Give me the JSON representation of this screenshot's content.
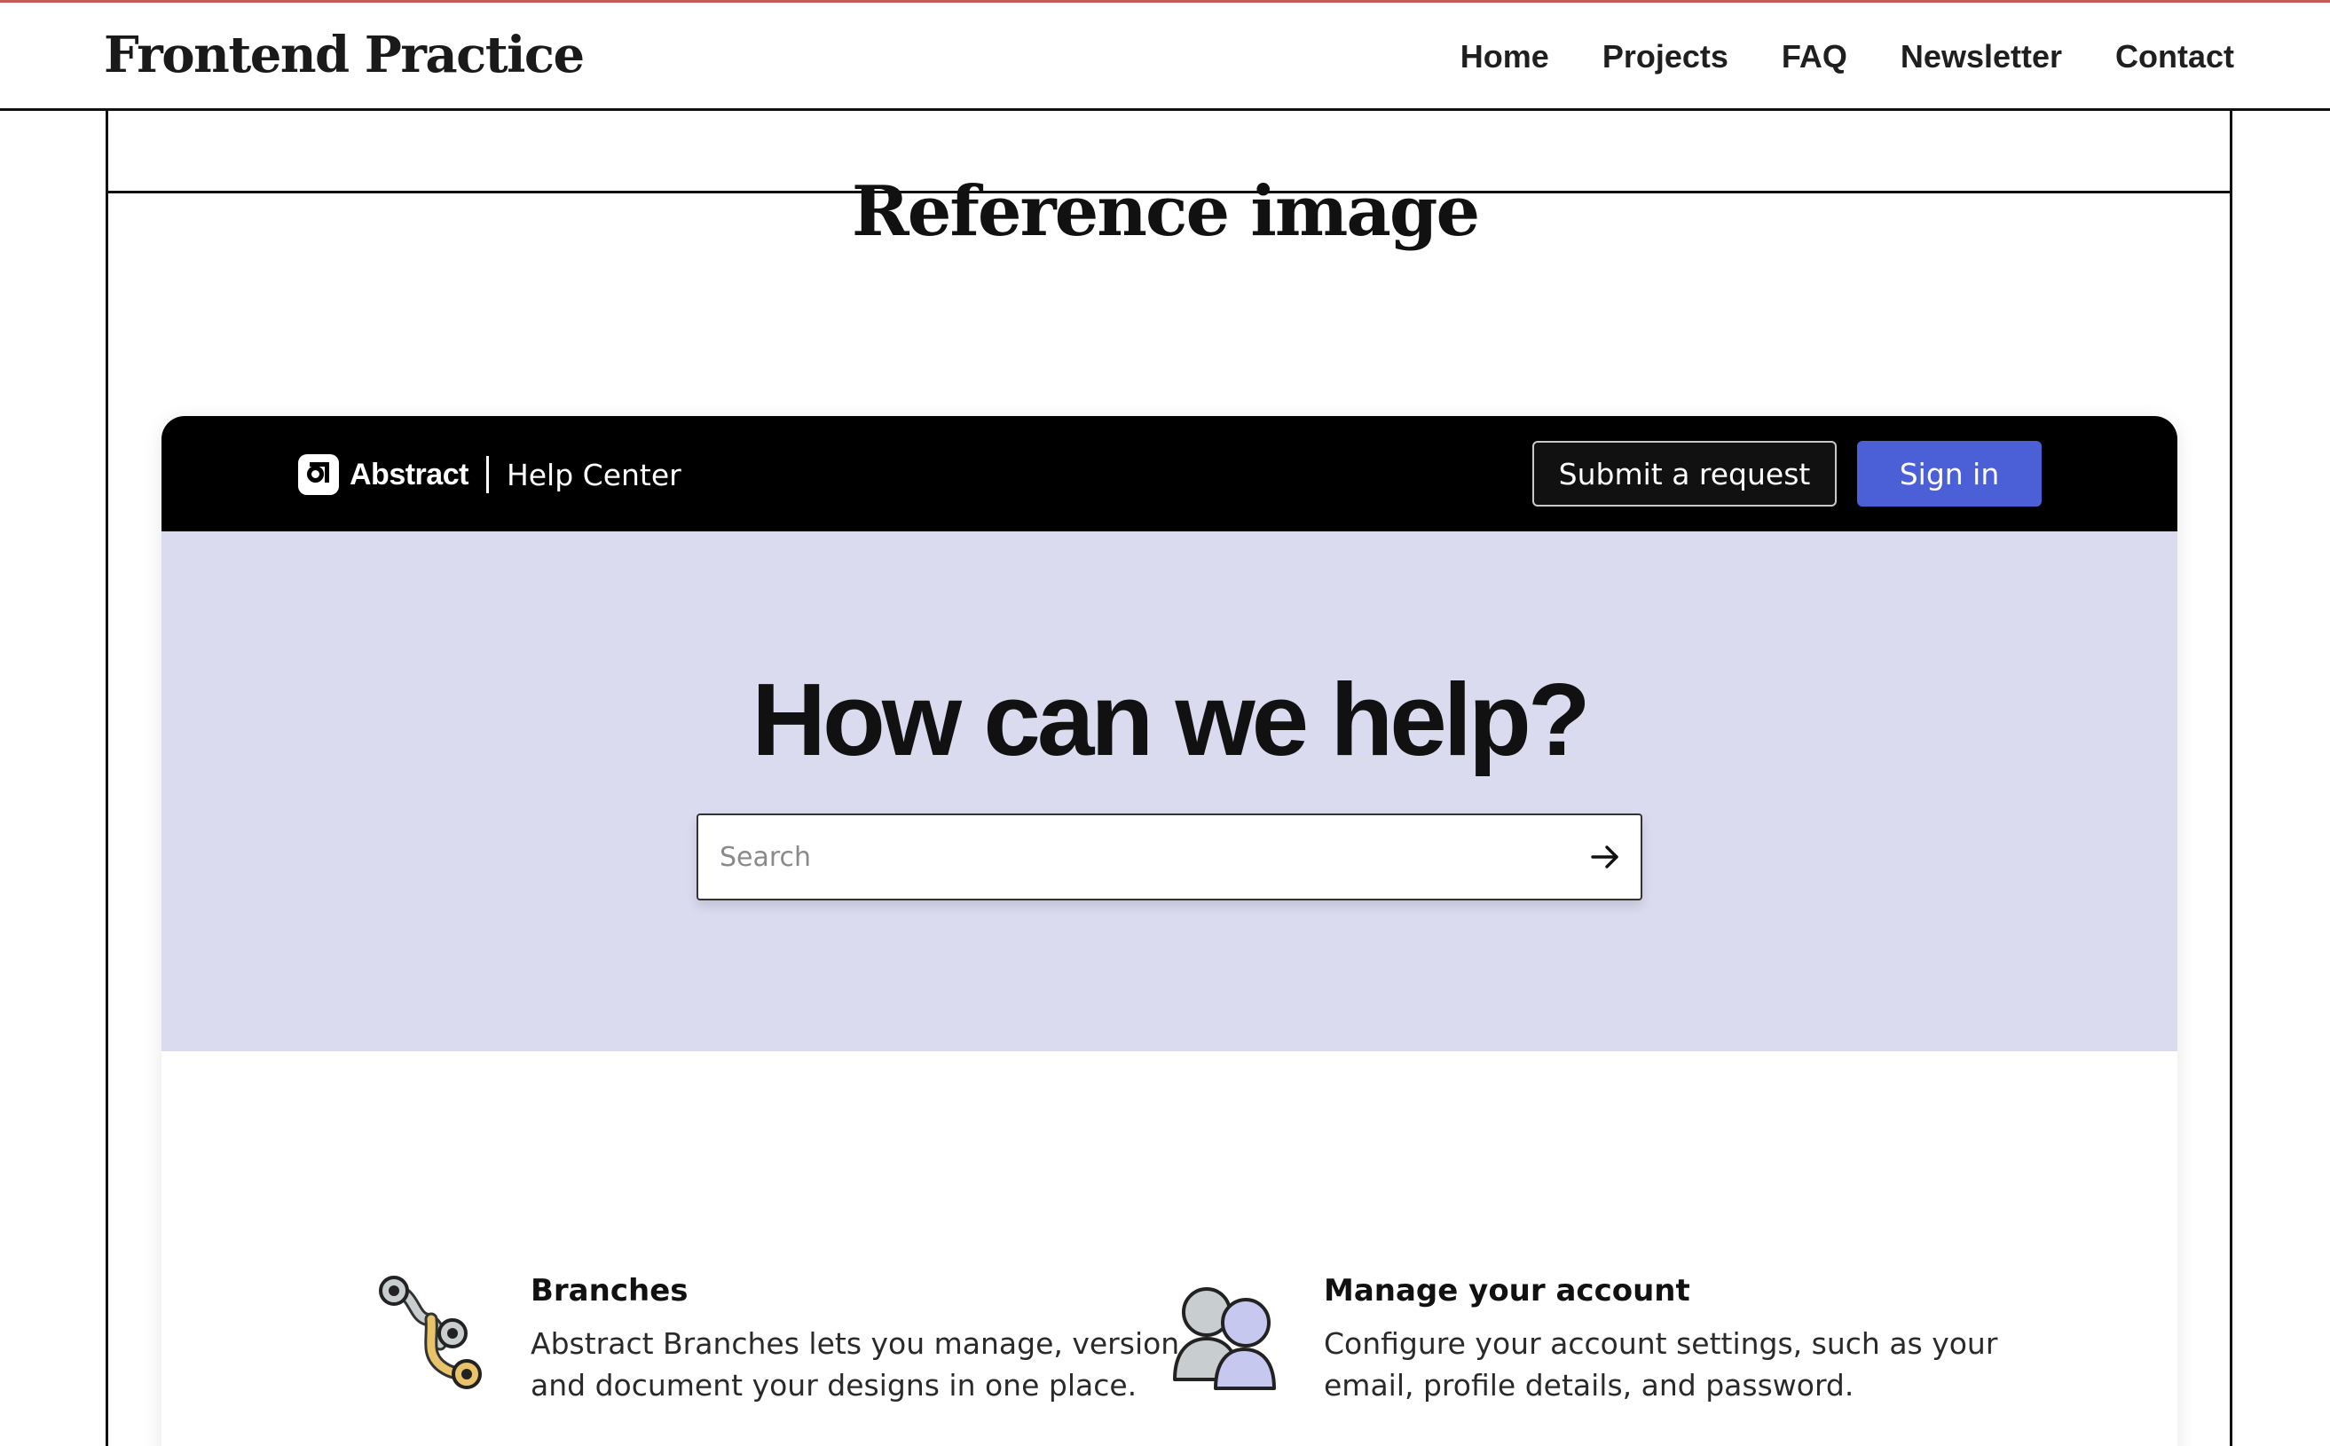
{
  "site": {
    "logo": "Frontend Practice",
    "nav": [
      "Home",
      "Projects",
      "FAQ",
      "Newsletter",
      "Contact"
    ]
  },
  "section_title": "Reference image",
  "app": {
    "brand_name": "Abstract",
    "brand_sub": "Help Center",
    "submit_label": "Submit a request",
    "signin_label": "Sign in",
    "colors": {
      "header_bg": "#000000",
      "signin_bg": "#4b5fd6",
      "hero_bg": "#dbdbf0"
    }
  },
  "hero": {
    "title": "How can we help?",
    "search_placeholder": "Search",
    "search_icon": "arrow-right-icon"
  },
  "features": [
    {
      "icon": "branches-icon",
      "title": "Branches",
      "text": "Abstract Branches lets you manage, version, and document your designs in one place."
    },
    {
      "icon": "users-icon",
      "title": "Manage your account",
      "text": "Configure your account settings, such as your email, profile details, and password."
    }
  ]
}
